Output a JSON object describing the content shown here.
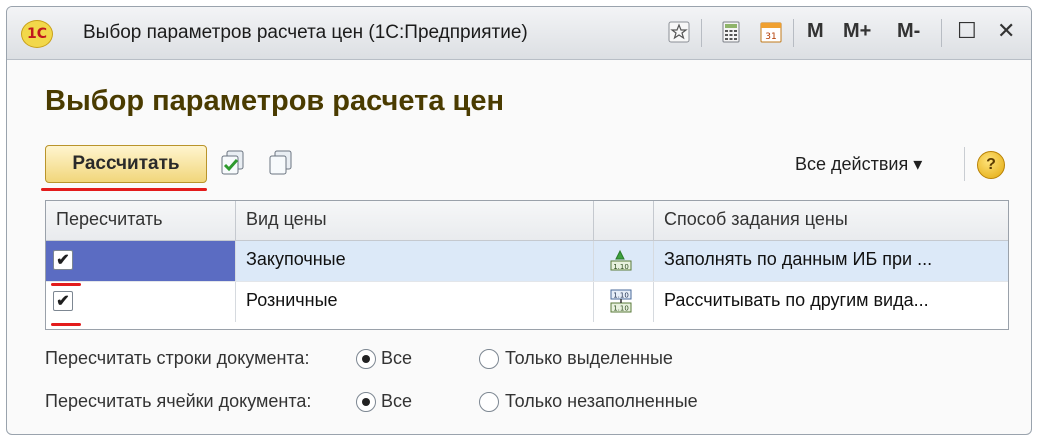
{
  "window": {
    "logo_text": "1С",
    "title": "Выбор параметров расчета цен  (1С:Предприятие)",
    "buttons": {
      "m": "M",
      "m_plus": "M+",
      "m_minus": "M-",
      "close": "✕",
      "restore": "☐"
    }
  },
  "form": {
    "heading": "Выбор параметров расчета цен",
    "calc_button": "Рассчитать",
    "all_actions": "Все действия ▾",
    "help": "?"
  },
  "table": {
    "columns": [
      "Пересчитать",
      "Вид цены",
      "",
      "Способ задания цены"
    ],
    "rows": [
      {
        "checked": true,
        "price_type": "Закупочные",
        "method": "Заполнять по данным ИБ при ...",
        "selected": true
      },
      {
        "checked": true,
        "price_type": "Розничные",
        "method": "Рассчитывать по другим вида...",
        "selected": false
      }
    ]
  },
  "options": {
    "rows_label": "Пересчитать строки документа:",
    "rows_all": "Все",
    "rows_selected": "Только выделенные",
    "cells_label": "Пересчитать ячейки документа:",
    "cells_all": "Все",
    "cells_empty": "Только незаполненные"
  },
  "colors": {
    "selected_row": "#dce9f8",
    "selected_cell": "#5b6cc2",
    "accent_red": "#e31b1b"
  }
}
